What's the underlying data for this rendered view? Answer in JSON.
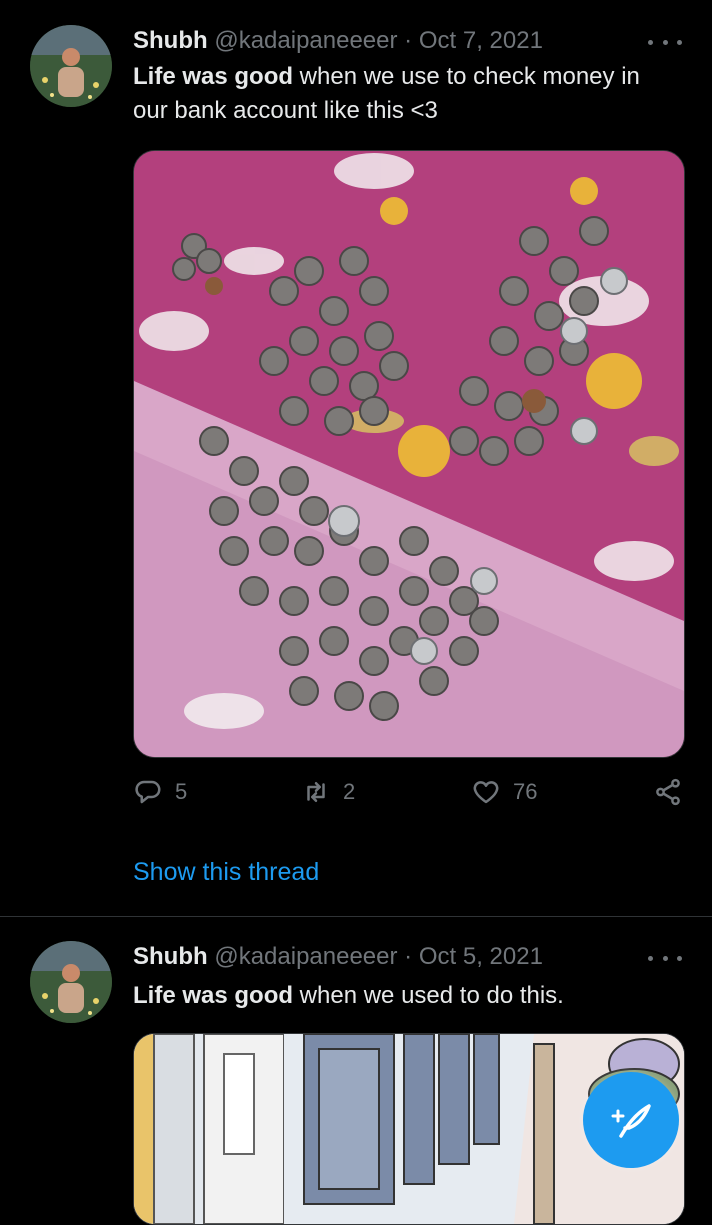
{
  "tweets": [
    {
      "name": "Shubh",
      "handle": "@kadaipaneeeer",
      "separator": "·",
      "date": "Oct 7, 2021",
      "text_bold": "Life was good",
      "text_rest": " when we use to check money in our bank account like this <3",
      "media_alt": "coins on a pink flowered bedsheet",
      "replies": "5",
      "retweets": "2",
      "likes": "76",
      "show_thread": "Show this thread"
    },
    {
      "name": "Shubh",
      "handle": "@kadaipaneeeer",
      "separator": "·",
      "date": "Oct 5, 2021",
      "text_bold": "Life was good",
      "text_rest": " when we used to do this."
    }
  ],
  "colors": {
    "background": "#000000",
    "text": "#e7e9ea",
    "muted": "#71767b",
    "accent": "#1d9bf0"
  },
  "icons": {
    "reply": "reply-icon",
    "retweet": "retweet-icon",
    "like": "heart-icon",
    "share": "share-icon",
    "more": "more-icon",
    "compose": "compose-tweet-icon"
  }
}
